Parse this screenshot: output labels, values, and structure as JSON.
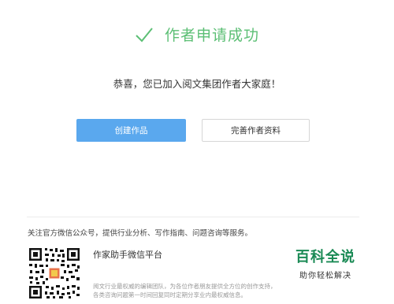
{
  "header": {
    "success_title": "作者申请成功",
    "welcome": "恭喜，您已加入阅文集团作者大家庭！"
  },
  "actions": {
    "create_label": "创建作品",
    "complete_profile_label": "完善作者资料"
  },
  "footer": {
    "follow_text": "关注官方微信公众号，提供行业分析、写作指南、问题咨询等服务。",
    "qr_title": "作家助手微信平台",
    "qr_desc_line1": "阅文行业最权威的编辑团队，为各位作者朋友提供全方位的创作支持，",
    "qr_desc_line2": "各类咨询问题第一时间回复同时定期分享业内最权威信息。"
  },
  "watermark": {
    "main": "百科全说",
    "sub": "助你轻松解决"
  },
  "colors": {
    "success_green": "#5cbf75",
    "primary_blue": "#5aa8ee",
    "watermark_green": "#1a8a55"
  }
}
